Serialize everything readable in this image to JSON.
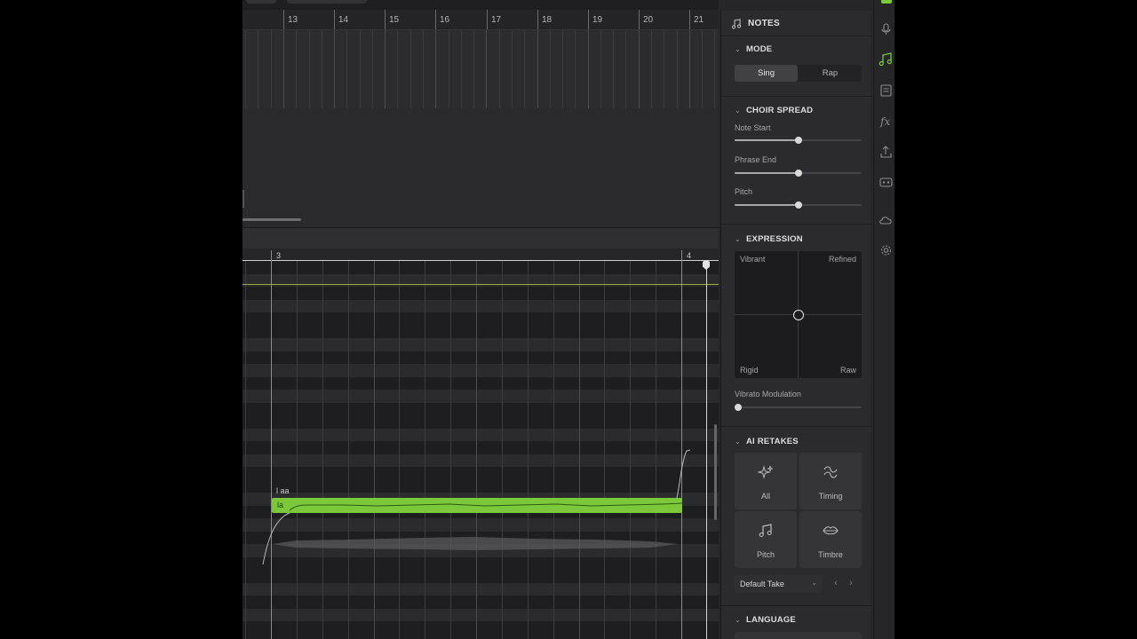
{
  "arrangement": {
    "bar_numbers": [
      "13",
      "14",
      "15",
      "16",
      "17",
      "18",
      "19",
      "20",
      "21"
    ]
  },
  "piano_roll": {
    "bar_numbers": [
      "3",
      "4"
    ],
    "note": {
      "lyric": "la",
      "phoneme": "l aa"
    }
  },
  "panel": {
    "title": "NOTES",
    "mode": {
      "title": "MODE",
      "options": [
        "Sing",
        "Rap"
      ],
      "selected": "Sing"
    },
    "choir_spread": {
      "title": "CHOIR SPREAD",
      "sliders": [
        {
          "label": "Note Start",
          "value": 0.5
        },
        {
          "label": "Phrase End",
          "value": 0.5
        },
        {
          "label": "Pitch",
          "value": 0.5
        }
      ]
    },
    "expression": {
      "title": "EXPRESSION",
      "corners": {
        "top_left": "Vibrant",
        "top_right": "Refined",
        "bottom_left": "Rigid",
        "bottom_right": "Raw"
      },
      "vibrato": {
        "label": "Vibrato Modulation",
        "value": 0
      }
    },
    "ai_retakes": {
      "title": "AI RETAKES",
      "buttons": [
        {
          "label": "All",
          "icon": "sparkles-icon"
        },
        {
          "label": "Timing",
          "icon": "timing-icon"
        },
        {
          "label": "Pitch",
          "icon": "music-note-icon"
        },
        {
          "label": "Timbre",
          "icon": "lips-icon"
        }
      ],
      "take": "Default Take"
    },
    "language": {
      "title": "LANGUAGE"
    }
  },
  "toolbar": {
    "tools": [
      "microphone-icon",
      "notes-icon",
      "lyrics-sheet-icon",
      "fx-icon",
      "export-icon",
      "ai-bot-icon",
      "cloud-icon",
      "settings-icon"
    ],
    "active_tool": "notes-icon",
    "accent": "#7bc83a"
  },
  "colors": {
    "note_fill": "#7bc83a",
    "automation_line": "#b8c93a"
  }
}
